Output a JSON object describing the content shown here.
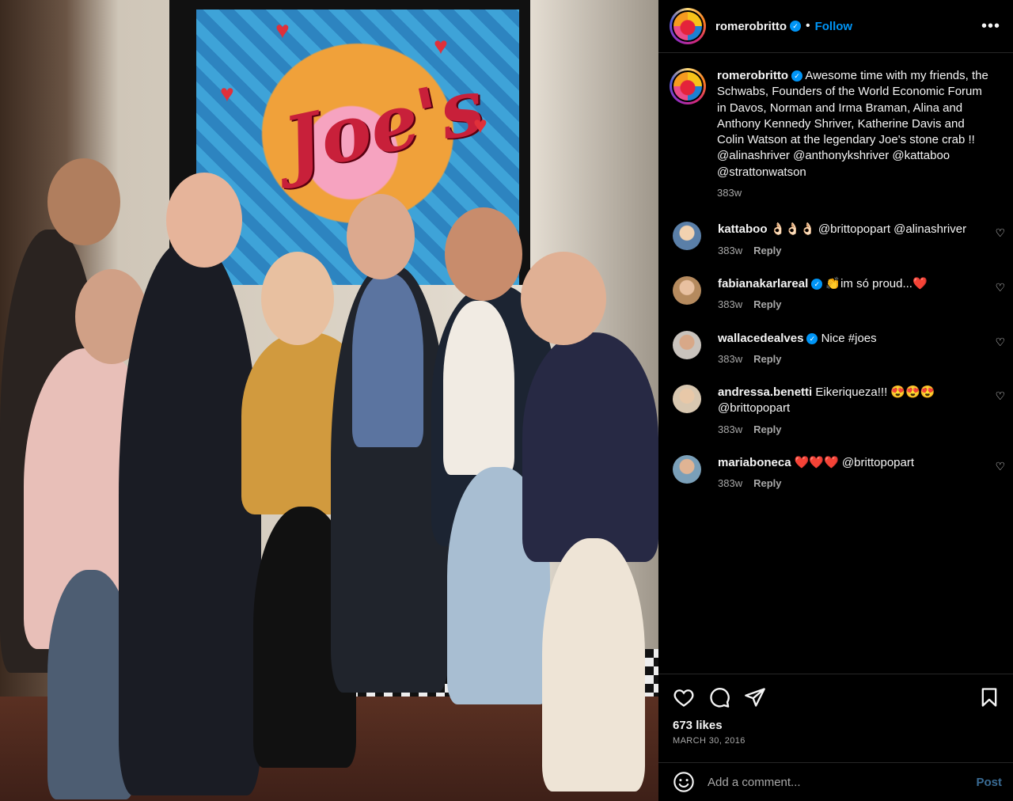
{
  "post": {
    "username": "romerobritto",
    "follow_label": "Follow",
    "separator": "•",
    "more_label": "•••",
    "caption": {
      "username": "romerobritto",
      "text": "Awesome time with my friends, the Schwabs, Founders of the World Economic Forum in Davos, Norman and Irma Braman, Alina and Anthony Kennedy Shriver, Katherine Davis and Colin Watson at the legendary Joe's stone crab !! @alinashriver @anthonykshriver @kattaboo @strattonwatson",
      "age": "383w"
    },
    "comments": [
      {
        "username": "kattaboo",
        "verified": false,
        "text": "👌🏻👌🏻👌🏻 @brittopopart @alinashriver",
        "age": "383w",
        "reply_label": "Reply",
        "avatar_color": "#5a7fa8"
      },
      {
        "username": "fabianakarlareal",
        "verified": true,
        "text": "👏im só proud...❤️",
        "age": "383w",
        "reply_label": "Reply",
        "avatar_color": "#b58a5e"
      },
      {
        "username": "wallacedealves",
        "verified": true,
        "text": "Nice #joes",
        "age": "383w",
        "reply_label": "Reply",
        "avatar_color": "#c9c3bd"
      },
      {
        "username": "andressa.benetti",
        "verified": false,
        "text": "Eikeriqueza!!! 😍😍😍 @brittopopart",
        "age": "383w",
        "reply_label": "Reply",
        "avatar_color": "#d8c7b0"
      },
      {
        "username": "mariaboneca",
        "verified": false,
        "text": "❤️❤️❤️ @brittopopart",
        "age": "383w",
        "reply_label": "Reply",
        "avatar_color": "#7a9fb8"
      }
    ],
    "likes": "673 likes",
    "date": "MARCH 30, 2016",
    "add_comment_placeholder": "Add a comment...",
    "post_label": "Post"
  },
  "icons": [
    "like-icon",
    "comment-icon",
    "share-icon",
    "save-icon",
    "emoji-icon",
    "more-options-icon",
    "verified-icon"
  ],
  "colors": {
    "accent": "#0095f6",
    "background": "#000000",
    "secondary_text": "#a8a8a8",
    "post_disabled": "#3a6c95"
  }
}
